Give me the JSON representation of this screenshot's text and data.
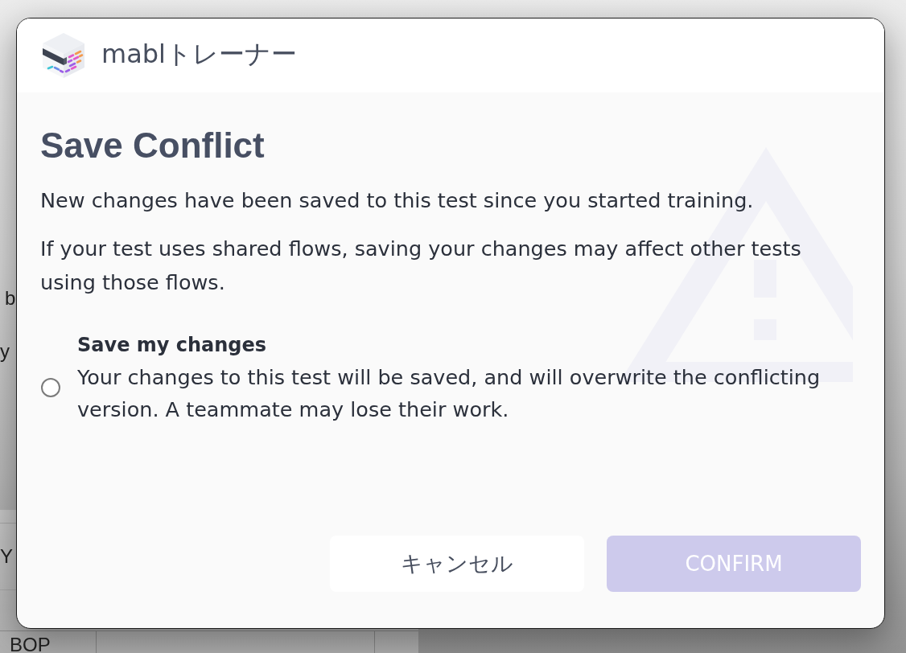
{
  "background": {
    "texts": [
      "b",
      "y",
      "Y",
      "BOP"
    ]
  },
  "dialog": {
    "app_title": "mablトレーナー",
    "title": "Save Conflict",
    "paragraphs": [
      "New changes have been saved to this test since you started training.",
      "If your test uses shared flows, saving your changes may affect other tests using those flows."
    ],
    "options": [
      {
        "label": "Save my changes",
        "description": "Your changes to this test will be saved, and will overwrite the conflicting version. A teammate may lose their work.",
        "selected": false
      }
    ],
    "buttons": [
      {
        "label": "キャンセル",
        "kind": "cancel",
        "disabled": false
      },
      {
        "label": "CONFIRM",
        "kind": "confirm",
        "disabled": true
      }
    ]
  }
}
